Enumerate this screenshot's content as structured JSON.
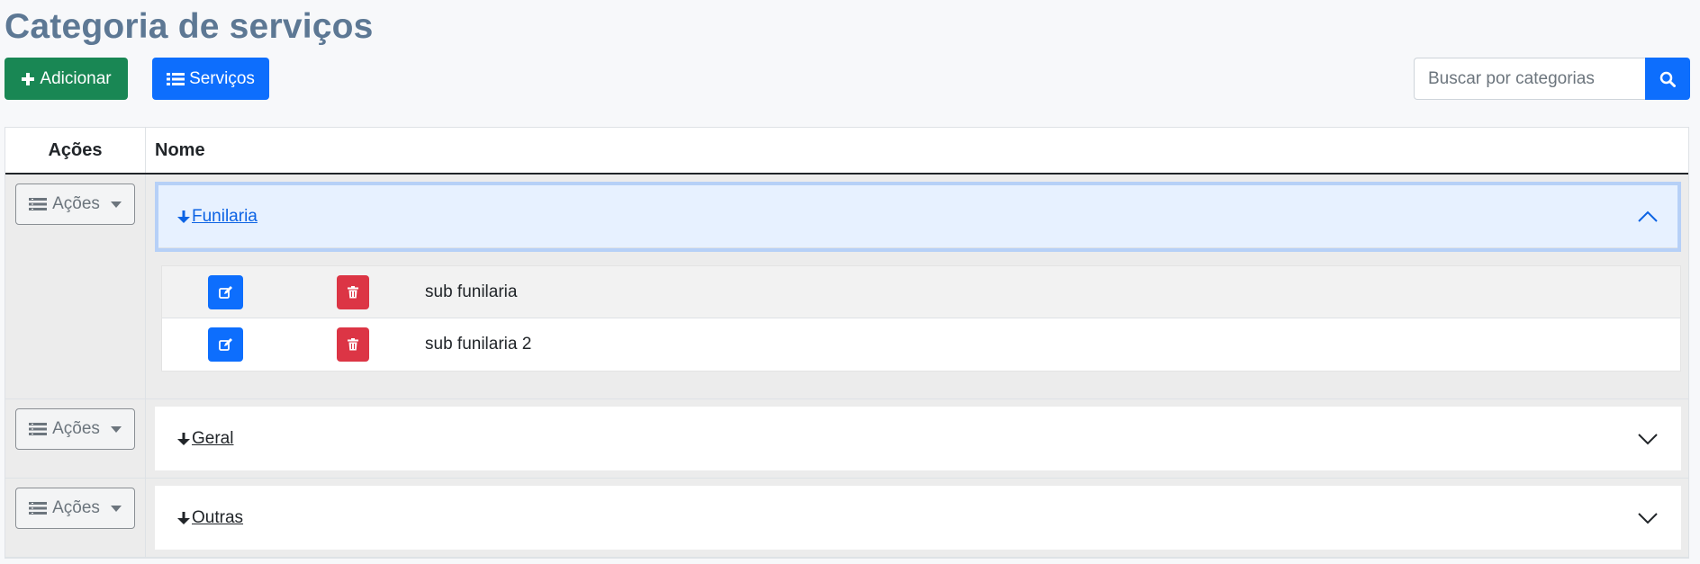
{
  "page": {
    "title": "Categoria de serviços"
  },
  "toolbar": {
    "add_label": "Adicionar",
    "services_label": "Serviços",
    "search_placeholder": "Buscar por categorias",
    "search_value": ""
  },
  "table": {
    "headers": {
      "actions": "Ações",
      "name": "Nome"
    },
    "actions_label": "Ações",
    "categories": [
      {
        "name": "Funilaria",
        "expanded": true,
        "subcategories": [
          {
            "name": "sub funilaria"
          },
          {
            "name": "sub funilaria 2"
          }
        ]
      },
      {
        "name": "Geral",
        "expanded": false
      },
      {
        "name": "Outras",
        "expanded": false
      }
    ]
  },
  "colors": {
    "title": "#5d7894",
    "success": "#198754",
    "primary": "#0d6efd",
    "danger": "#dc3545",
    "accordion_open_bg": "#e7f1ff"
  }
}
